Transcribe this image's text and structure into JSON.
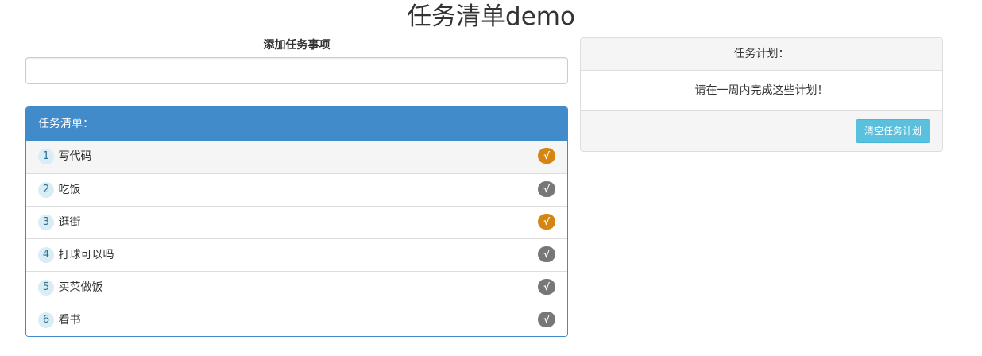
{
  "page": {
    "title": "任务清单demo"
  },
  "add_task": {
    "label": "添加任务事项",
    "value": "",
    "placeholder": ""
  },
  "task_list": {
    "heading": "任务清单：",
    "items": [
      {
        "number": "1",
        "text": "写代码",
        "check_glyph": "√",
        "check_color": "#d58512",
        "active": true
      },
      {
        "number": "2",
        "text": "吃饭",
        "check_glyph": "√",
        "check_color": "#777777",
        "active": false
      },
      {
        "number": "3",
        "text": "逛街",
        "check_glyph": "√",
        "check_color": "#d58512",
        "active": false
      },
      {
        "number": "4",
        "text": "打球可以吗",
        "check_glyph": "√",
        "check_color": "#777777",
        "active": false
      },
      {
        "number": "5",
        "text": "买菜做饭",
        "check_glyph": "√",
        "check_color": "#777777",
        "active": false
      },
      {
        "number": "6",
        "text": "看书",
        "check_glyph": "√",
        "check_color": "#777777",
        "active": false
      }
    ]
  },
  "plan": {
    "heading": "任务计划：",
    "message": "请在一周内完成这些计划！",
    "clear_button": "清空任务计划"
  },
  "colors": {
    "primary": "#428bca",
    "info": "#5bc0de",
    "warning": "#d58512",
    "default": "#777777",
    "badge_bg": "#d9edf7"
  }
}
